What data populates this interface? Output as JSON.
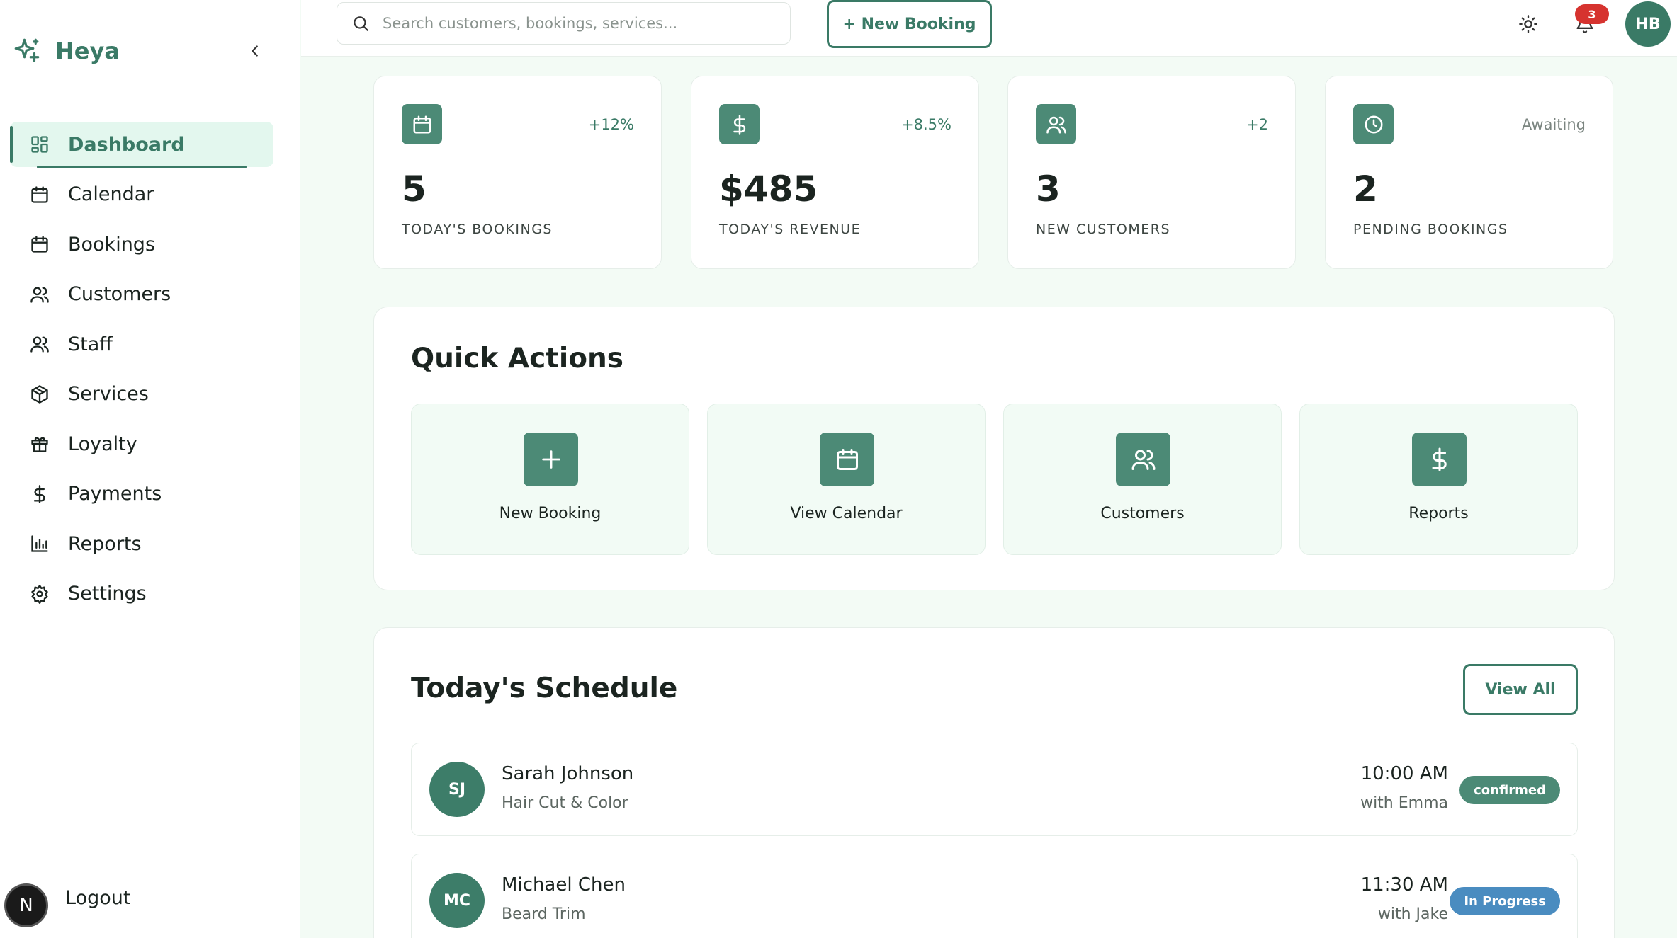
{
  "brand": {
    "name": "Heya"
  },
  "sidebar": {
    "items": [
      {
        "label": "Dashboard",
        "icon": "dashboard-icon",
        "active": true
      },
      {
        "label": "Calendar",
        "icon": "calendar-icon"
      },
      {
        "label": "Bookings",
        "icon": "calendar-icon"
      },
      {
        "label": "Customers",
        "icon": "users-icon"
      },
      {
        "label": "Staff",
        "icon": "users-icon"
      },
      {
        "label": "Services",
        "icon": "box-icon"
      },
      {
        "label": "Loyalty",
        "icon": "gift-icon"
      },
      {
        "label": "Payments",
        "icon": "dollar-icon"
      },
      {
        "label": "Reports",
        "icon": "bar-chart-icon"
      },
      {
        "label": "Settings",
        "icon": "gear-icon"
      }
    ],
    "logout_label": "Logout",
    "footer_badge": "N"
  },
  "topbar": {
    "search_placeholder": "Search customers, bookings, services...",
    "new_booking_label": "+ New Booking",
    "notification_count": "3",
    "user_initials": "HB"
  },
  "stats": [
    {
      "value": "5",
      "label": "TODAY'S BOOKINGS",
      "change": "+12%",
      "icon": "calendar-icon"
    },
    {
      "value": "$485",
      "label": "TODAY'S REVENUE",
      "change": "+8.5%",
      "icon": "dollar-icon"
    },
    {
      "value": "3",
      "label": "NEW CUSTOMERS",
      "change": "+2",
      "icon": "users-icon"
    },
    {
      "value": "2",
      "label": "PENDING BOOKINGS",
      "change": "Awaiting",
      "icon": "clock-icon"
    }
  ],
  "quick_actions": {
    "title": "Quick Actions",
    "items": [
      {
        "label": "New Booking",
        "icon": "plus-icon"
      },
      {
        "label": "View Calendar",
        "icon": "calendar-icon"
      },
      {
        "label": "Customers",
        "icon": "users-icon"
      },
      {
        "label": "Reports",
        "icon": "dollar-icon"
      }
    ]
  },
  "schedule": {
    "title": "Today's Schedule",
    "view_all_label": "View All",
    "rows": [
      {
        "initials": "SJ",
        "name": "Sarah Johnson",
        "service": "Hair Cut & Color",
        "time": "10:00 AM",
        "staff": "with Emma",
        "status": "confirmed"
      },
      {
        "initials": "MC",
        "name": "Michael Chen",
        "service": "Beard Trim",
        "time": "11:30 AM",
        "staff": "with Jake",
        "status": "In Progress"
      }
    ]
  },
  "colors": {
    "accent": "#3a7a66",
    "icon_bg": "#4c8a76",
    "page_bg": "#f3fbf5",
    "badge_red": "#d6332f",
    "status_blue": "#4a8cc0"
  }
}
